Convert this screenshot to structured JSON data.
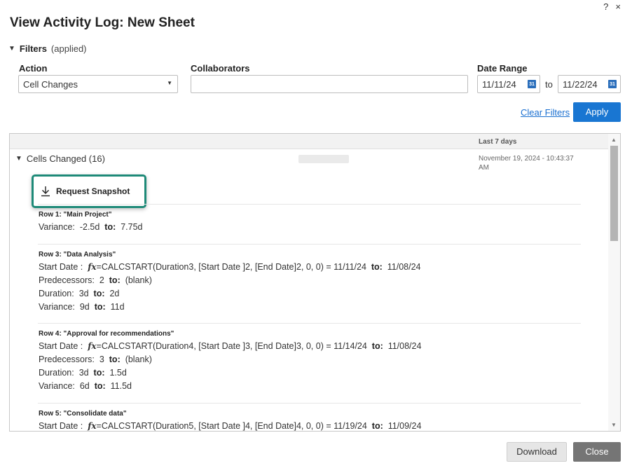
{
  "window": {
    "help_label": "?",
    "close_label": "×",
    "title": "View Activity Log: New Sheet"
  },
  "filters": {
    "label": "Filters",
    "status": "(applied)",
    "action_label": "Action",
    "action_value": "Cell Changes",
    "collaborators_label": "Collaborators",
    "collaborators_value": "",
    "date_range_label": "Date Range",
    "date_from": "11/11/24",
    "date_to": "11/22/24",
    "to_label": "to",
    "calendar_glyph": "31",
    "clear_label": "Clear Filters",
    "apply_label": "Apply"
  },
  "log": {
    "period_label": "Last 7 days",
    "group_label": "Cells Changed (16)",
    "timestamp_line1": "November 19, 2024 - 10:43:37",
    "timestamp_line2": "AM",
    "snapshot_label": "Request Snapshot",
    "to_word": "to:",
    "fx_glyph": "fx",
    "rows": [
      {
        "title": "Row 1: \"Main Project\"",
        "changes": [
          {
            "field": "Variance:",
            "from": "-2.5d",
            "to": "7.75d"
          }
        ]
      },
      {
        "title": "Row 3: \"Data Analysis\"",
        "formula": {
          "field": "Start Date :",
          "from": "=CALCSTART(Duration3, [Start Date ]2, [End Date]2, 0, 0) = 11/11/24",
          "to": "11/08/24"
        },
        "changes": [
          {
            "field": "Predecessors:",
            "from": "2",
            "to": "(blank)"
          },
          {
            "field": "Duration:",
            "from": "3d",
            "to": "2d"
          },
          {
            "field": "Variance:",
            "from": "9d",
            "to": "11d"
          }
        ]
      },
      {
        "title": "Row 4: \"Approval for recommendations\"",
        "formula": {
          "field": "Start Date :",
          "from": "=CALCSTART(Duration4, [Start Date ]3, [End Date]3, 0, 0) = 11/14/24",
          "to": "11/08/24"
        },
        "changes": [
          {
            "field": "Predecessors:",
            "from": "3",
            "to": "(blank)"
          },
          {
            "field": "Duration:",
            "from": "3d",
            "to": "1.5d"
          },
          {
            "field": "Variance:",
            "from": "6d",
            "to": "11.5d"
          }
        ]
      },
      {
        "title": "Row 5: \"Consolidate data\"",
        "formula": {
          "field": "Start Date :",
          "from": "=CALCSTART(Duration5, [Start Date ]4, [End Date]4, 0, 0) = 11/19/24",
          "to": "11/09/24"
        }
      }
    ]
  },
  "footer": {
    "download_label": "Download",
    "close_label": "Close"
  },
  "colors": {
    "primary": "#1976d2",
    "link": "#1a6fd0",
    "highlight": "#1e8a78",
    "close_button": "#757575"
  }
}
